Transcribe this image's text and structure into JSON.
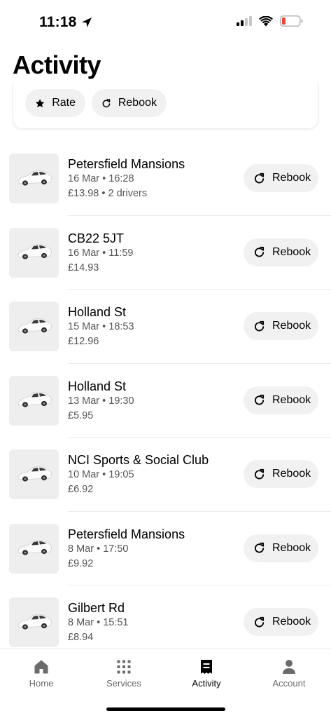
{
  "status_bar": {
    "time": "11:18",
    "location_icon": "location-arrow-icon",
    "signal_icon": "cellular-signal-icon",
    "wifi_icon": "wifi-icon",
    "battery_icon": "battery-low-icon",
    "battery_color": "#e5483a"
  },
  "page": {
    "title": "Activity"
  },
  "top_card": {
    "rate_label": "Rate",
    "rebook_label": "Rebook"
  },
  "trips": [
    {
      "title": "Petersfield Mansions",
      "datetime": "16 Mar • 16:28",
      "price": "£13.98 • 2 drivers",
      "rebook_label": "Rebook"
    },
    {
      "title": "CB22 5JT",
      "datetime": "16 Mar • 11:59",
      "price": "£14.93",
      "rebook_label": "Rebook"
    },
    {
      "title": "Holland St",
      "datetime": "15 Mar • 18:53",
      "price": "£12.96",
      "rebook_label": "Rebook"
    },
    {
      "title": "Holland St",
      "datetime": "13 Mar • 19:30",
      "price": "£5.95",
      "rebook_label": "Rebook"
    },
    {
      "title": "NCI Sports & Social Club",
      "datetime": "10 Mar • 19:05",
      "price": "£6.92",
      "rebook_label": "Rebook"
    },
    {
      "title": "Petersfield Mansions",
      "datetime": "8 Mar • 17:50",
      "price": "£9.92",
      "rebook_label": "Rebook"
    },
    {
      "title": "Gilbert Rd",
      "datetime": "8 Mar • 15:51",
      "price": "£8.94",
      "rebook_label": "Rebook"
    }
  ],
  "tab_bar": {
    "home": "Home",
    "services": "Services",
    "activity": "Activity",
    "account": "Account",
    "active_tab": "activity"
  }
}
